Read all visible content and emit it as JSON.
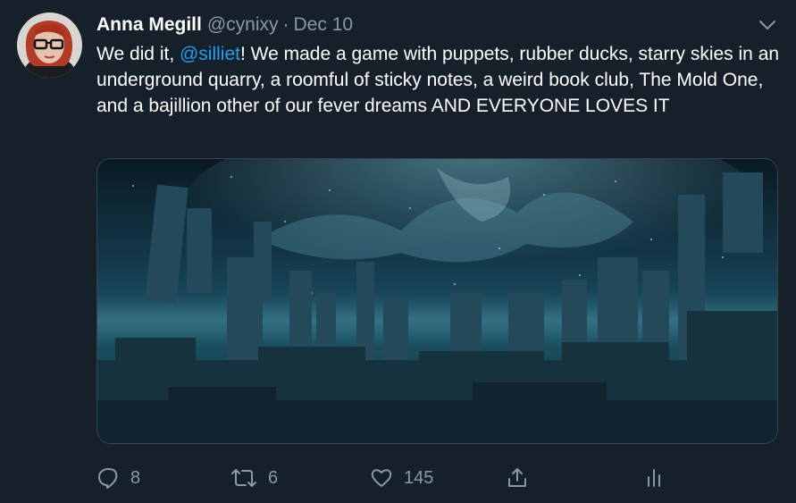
{
  "tweet": {
    "author_name": "Anna Megill",
    "handle": "@cynixy",
    "separator": "·",
    "date": "Dec 10",
    "text_before_mention": "We did it, ",
    "mention": "@silliet",
    "text_after_mention": "! We made a game with puppets, rubber ducks, starry skies in an underground quarry, a roomful of sticky notes, a weird book club, The Mold One, and a bajillion other of our fever dreams AND EVERYONE LOVES IT"
  },
  "actions": {
    "reply_count": "8",
    "retweet_count": "6",
    "like_count": "145"
  },
  "icons": {
    "reply": "reply-icon",
    "retweet": "retweet-icon",
    "like": "heart-icon",
    "share": "share-icon",
    "analytics": "analytics-icon",
    "menu": "chevron-down-icon"
  },
  "colors": {
    "background": "#15202b",
    "text": "#ffffff",
    "secondary_text": "#8899a6",
    "link": "#1da1f2",
    "border": "#38444d"
  }
}
